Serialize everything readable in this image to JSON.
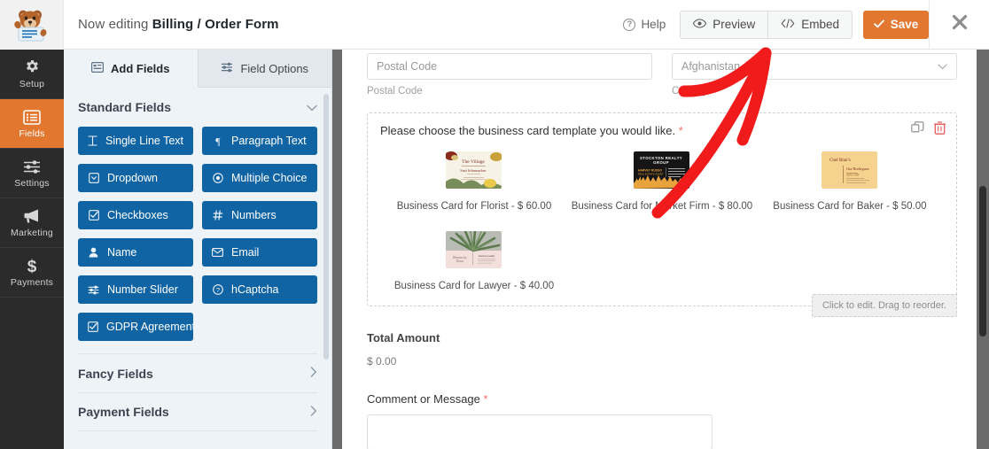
{
  "topbar": {
    "logo_icon": "wpforms-bear-mascot-icon",
    "editing_prefix": "Now editing ",
    "form_name": "Billing / Order Form",
    "help_label": "Help",
    "help_icon": "question-circle-icon",
    "preview_label": "Preview",
    "preview_icon": "eye-icon",
    "embed_label": "Embed",
    "embed_icon": "code-brackets-icon",
    "save_label": "Save",
    "save_icon": "check-icon",
    "close_icon": "close-x-icon",
    "accent_color": "#e27730"
  },
  "rail": {
    "items": [
      {
        "label": "Setup",
        "icon": "gear-icon",
        "active": false
      },
      {
        "label": "Fields",
        "icon": "list-icon",
        "active": true
      },
      {
        "label": "Settings",
        "icon": "sliders-icon",
        "active": false
      },
      {
        "label": "Marketing",
        "icon": "megaphone-icon",
        "active": false
      },
      {
        "label": "Payments",
        "icon": "dollar-icon",
        "active": false
      }
    ]
  },
  "panel": {
    "tabs": [
      {
        "label": "Add Fields",
        "icon": "add-fields-icon",
        "active": true
      },
      {
        "label": "Field Options",
        "icon": "field-options-icon",
        "active": false
      }
    ],
    "standard_section": {
      "title": "Standard Fields",
      "chevron": "chevron-down-icon"
    },
    "fields": [
      {
        "label": "Single Line Text",
        "icon": "text-cursor-icon"
      },
      {
        "label": "Paragraph Text",
        "icon": "pilcrow-icon"
      },
      {
        "label": "Dropdown",
        "icon": "dropdown-icon"
      },
      {
        "label": "Multiple Choice",
        "icon": "radio-icon"
      },
      {
        "label": "Checkboxes",
        "icon": "checkbox-icon"
      },
      {
        "label": "Numbers",
        "icon": "hash-icon"
      },
      {
        "label": "Name",
        "icon": "user-icon"
      },
      {
        "label": "Email",
        "icon": "envelope-icon"
      },
      {
        "label": "Number Slider",
        "icon": "slider-icon"
      },
      {
        "label": "hCaptcha",
        "icon": "captcha-icon"
      },
      {
        "label": "GDPR Agreement",
        "icon": "checkbox-icon"
      }
    ],
    "accordion": [
      {
        "label": "Fancy Fields",
        "chevron": "chevron-right-icon"
      },
      {
        "label": "Payment Fields",
        "chevron": "chevron-right-icon"
      }
    ]
  },
  "form": {
    "postal": {
      "value": "Postal Code",
      "sublabel": "Postal Code"
    },
    "country": {
      "value": "Afghanistan",
      "sublabel": "Country",
      "chevron": "chevron-down-icon"
    },
    "choice_field": {
      "label": "Please choose the business card template you would like.",
      "required_mark": "*",
      "duplicate_icon": "duplicate-icon",
      "delete_icon": "trash-icon",
      "options": [
        {
          "caption": "Business Card for Florist - $ 60.00",
          "thumb": "florist-card-thumbnail"
        },
        {
          "caption": "Business Card for Market Firm - $ 80.00",
          "thumb": "market-firm-card-thumbnail"
        },
        {
          "caption": "Business Card for Baker - $ 50.00",
          "thumb": "baker-card-thumbnail"
        },
        {
          "caption": "Business Card for Lawyer - $ 40.00",
          "thumb": "lawyer-card-thumbnail"
        }
      ],
      "drag_hint": "Click to edit. Drag to reorder."
    },
    "total": {
      "label": "Total Amount",
      "value": "$ 0.00"
    },
    "comment": {
      "label": "Comment or Message",
      "required_mark": "*",
      "value": ""
    }
  },
  "annotation": {
    "type": "red-arrow",
    "color": "#f21b1b",
    "points_to": "preview-button"
  }
}
